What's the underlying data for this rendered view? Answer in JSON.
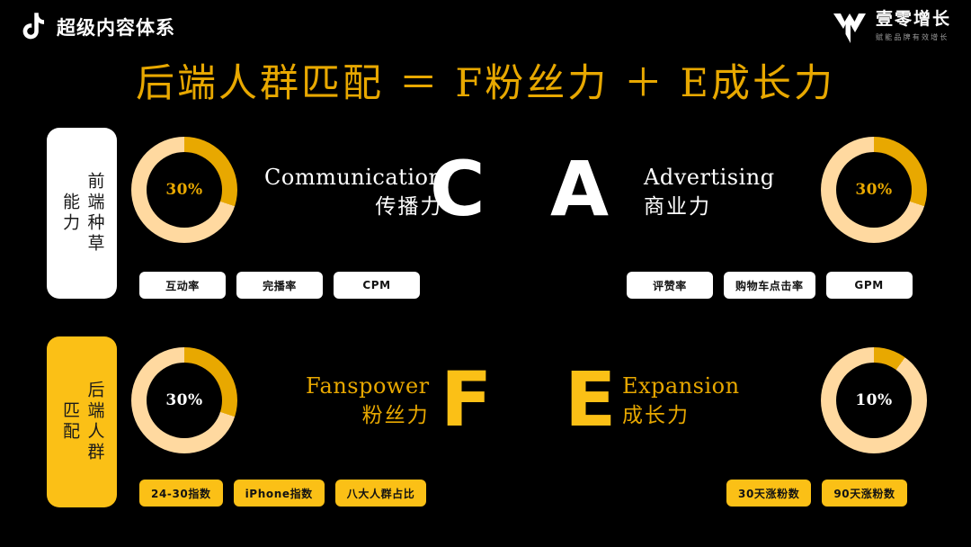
{
  "header": {
    "platform_icon": "tiktok-music-note-icon",
    "title": "超级内容体系",
    "brand": {
      "mark_icon": "yiling-chevron-logo-icon",
      "name": "壹零增长",
      "tagline": "赋能品牌有效增长"
    }
  },
  "main_title": "后端人群匹配 ＝ F粉丝力 ＋ E成长力",
  "colors": {
    "background": "#000000",
    "gold": "#E8A800",
    "yellow": "#FBC016",
    "cream": "#FFD9A0",
    "white": "#FFFFFF"
  },
  "rows": [
    {
      "panel": {
        "label": "前端种草能力",
        "style": "white"
      },
      "blocks": [
        {
          "letter": "C",
          "letter_color": "#FFFFFF",
          "en": "Communication",
          "cn": "传播力",
          "text_color": "#FFFFFF",
          "donut": {
            "percent_label": "30%",
            "percent": 30,
            "text_color": "#E8A800"
          },
          "tags": [
            "互动率",
            "完播率",
            "CPM"
          ],
          "tag_style": "light"
        },
        {
          "letter": "A",
          "letter_color": "#FFFFFF",
          "en": "Advertising",
          "cn": "商业力",
          "text_color": "#FFFFFF",
          "donut": {
            "percent_label": "30%",
            "percent": 30,
            "text_color": "#E8A800"
          },
          "tags": [
            "评赞率",
            "购物车点击率",
            "GPM"
          ],
          "tag_style": "light"
        }
      ]
    },
    {
      "panel": {
        "label": "后端人群匹配",
        "style": "yellow"
      },
      "blocks": [
        {
          "letter": "F",
          "letter_color": "#FBC016",
          "en": "Fanspower",
          "cn": "粉丝力",
          "text_color": "#E8A800",
          "donut": {
            "percent_label": "30%",
            "percent": 30,
            "text_color": "#FFFFFF"
          },
          "tags": [
            "24-30指数",
            "iPhone指数",
            "八大人群占比"
          ],
          "tag_style": "gold"
        },
        {
          "letter": "E",
          "letter_color": "#FBC016",
          "en": "Expansion",
          "cn": "成长力",
          "text_color": "#E8A800",
          "donut": {
            "percent_label": "10%",
            "percent": 10,
            "text_color": "#FFFFFF"
          },
          "tags": [
            "30天涨粉数",
            "90天涨粉数"
          ],
          "tag_style": "gold"
        }
      ]
    }
  ],
  "chart_data": {
    "type": "pie",
    "title": "后端人群匹配 ＝ F粉丝力 ＋ E成长力",
    "charts": [
      {
        "name": "Communication 传播力",
        "value": 30,
        "label": "30%",
        "remainder": 70
      },
      {
        "name": "Advertising 商业力",
        "value": 30,
        "label": "30%",
        "remainder": 70
      },
      {
        "name": "Fanspower 粉丝力",
        "value": 30,
        "label": "30%",
        "remainder": 70
      },
      {
        "name": "Expansion 成长力",
        "value": 10,
        "label": "10%",
        "remainder": 90
      }
    ]
  }
}
